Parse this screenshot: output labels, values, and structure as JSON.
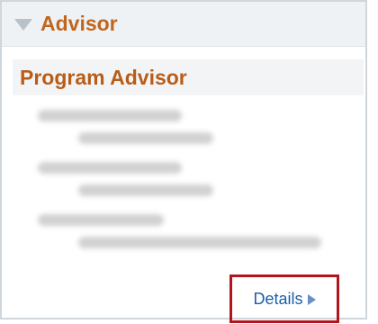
{
  "panel": {
    "title": "Advisor",
    "section_title": "Program Advisor",
    "details_label": "Details",
    "collapse_icon": "triangle-down-icon",
    "details_icon": "arrow-right-icon",
    "title_color": "#c1661c",
    "highlight_color": "#b3151f"
  }
}
